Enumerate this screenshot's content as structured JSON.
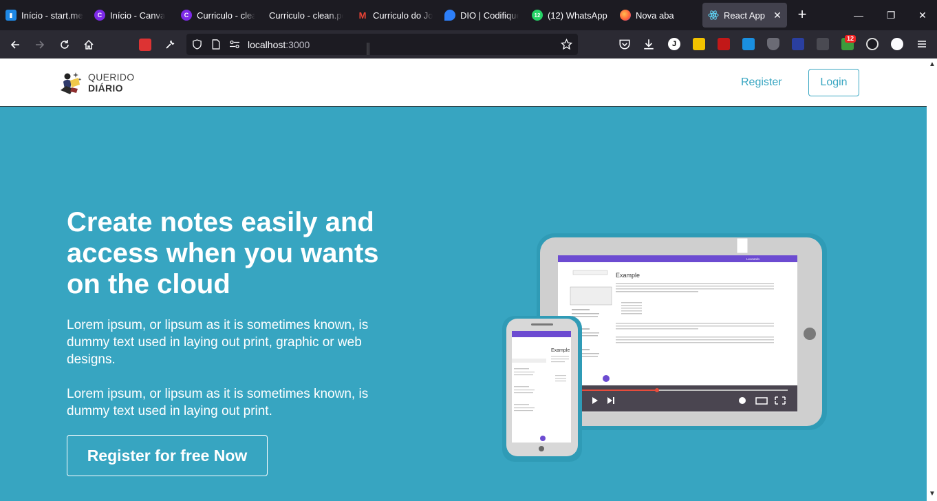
{
  "browser": {
    "tabs": [
      {
        "label": "Início - start.me",
        "icon": "startme-icon"
      },
      {
        "label": "Início - Canva",
        "icon": "canva-icon"
      },
      {
        "label": "Curriculo - clean",
        "icon": "canva-icon"
      },
      {
        "label": "Curriculo - clean.pd",
        "icon": "document-icon"
      },
      {
        "label": "Curriculo do Jor",
        "icon": "gmail-icon"
      },
      {
        "label": "DIO | Codifique",
        "icon": "dio-icon"
      },
      {
        "label": "(12) WhatsApp",
        "icon": "whatsapp-icon"
      },
      {
        "label": "Nova aba",
        "icon": "firefox-icon"
      },
      {
        "label": "React App",
        "icon": "react-icon"
      }
    ],
    "url_host": "localhost",
    "url_port": ":3000",
    "whatsapp_badge": "12",
    "extension_badge": "12"
  },
  "header": {
    "logo_line1": "QUERIDO",
    "logo_line2": "DIÁRIO",
    "register_label": "Register",
    "login_label": "Login"
  },
  "hero": {
    "title": "Create notes easily and access when you wants on the cloud",
    "paragraph1": "Lorem ipsum, or lipsum as it is sometimes known, is dummy text used in laying out print, graphic or web designs.",
    "paragraph2": "Lorem ipsum, or lipsum as it is sometimes known, is dummy text used in laying out print.",
    "cta_label": "Register for free Now"
  },
  "illustration": {
    "tablet_heading": "Example",
    "phone_heading": "Example",
    "tablet_user": "Leonardo"
  },
  "colors": {
    "hero_bg": "#37a5c1",
    "accent": "#37a5c1",
    "app_purple": "#6c4bd1",
    "video_progress": "#e74c3c"
  }
}
